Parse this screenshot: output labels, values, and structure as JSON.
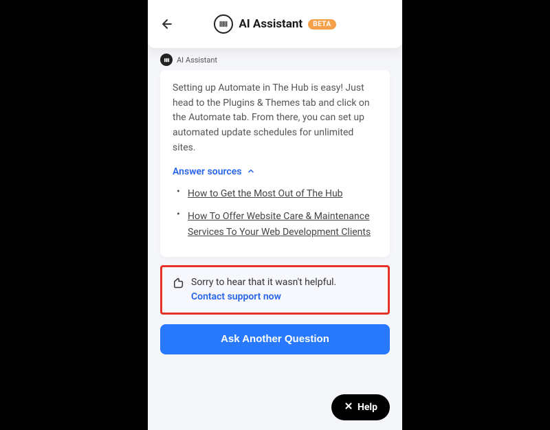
{
  "header": {
    "title": "AI Assistant",
    "badge": "BETA"
  },
  "sender": "AI Assistant",
  "answer": "Setting up Automate in The Hub is easy! Just head to the Plugins & Themes tab and click on the Automate tab. From there, you can set up automated update schedules for unlimited sites.",
  "sources": {
    "label": "Answer sources",
    "items": [
      "How to Get the Most Out of The Hub",
      "How To Offer Website Care & Maintenance Services To Your Web Development Clients"
    ]
  },
  "feedback": {
    "message": "Sorry to hear that it wasn't helpful.",
    "link": "Contact support now"
  },
  "ask_button": "Ask Another Question",
  "help_button": "Help"
}
